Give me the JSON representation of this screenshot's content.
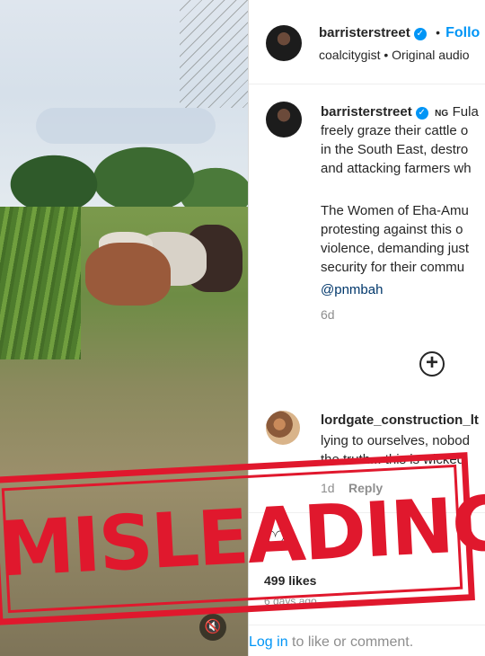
{
  "header": {
    "username": "barristerstreet",
    "separator": "•",
    "follow_label": "Follo",
    "subtitle": "coalcitygist • Original audio"
  },
  "post": {
    "username": "barristerstreet",
    "flag_code": "NG",
    "caption_lines": [
      "Fula",
      "freely graze their cattle o",
      "in the South East, destro",
      "and attacking farmers wh",
      "",
      "The Women of Eha-Amu",
      "protesting against this o",
      "violence, demanding just",
      "security for their commu"
    ],
    "mention": "@pnmbah",
    "age": "6d"
  },
  "comment": {
    "username": "lordgate_construction_lt",
    "text_lines": [
      "lying to ourselves, nobod",
      "the truth... this is wicked"
    ],
    "age": "1d",
    "reply_label": "Reply"
  },
  "footer": {
    "likes": "499 likes",
    "date": "6 days ago",
    "login_link": "Log in",
    "login_rest": " to like or comment."
  },
  "stamp": {
    "text": "MISLEADING"
  },
  "colors": {
    "accent": "#0095f6",
    "stamp": "#e0182d"
  },
  "icons": [
    "verified-badge-icon",
    "new-comment-plus-icon",
    "mute-icon",
    "heart-icon"
  ]
}
